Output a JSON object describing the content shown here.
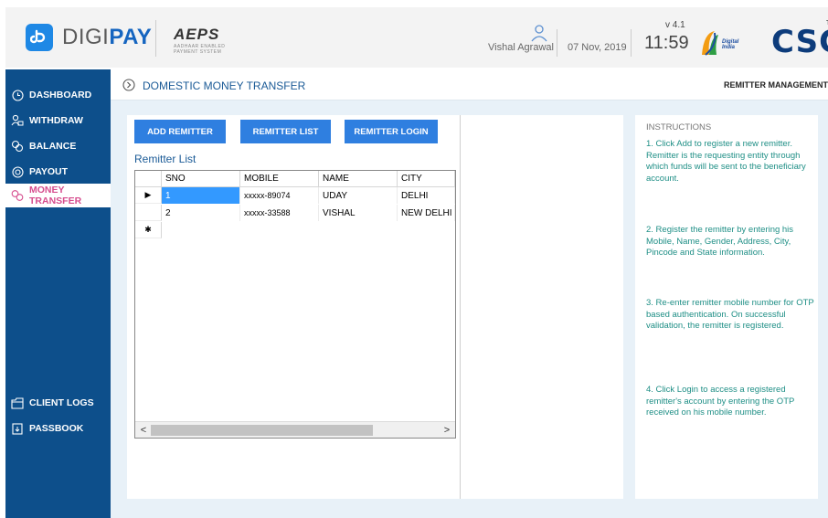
{
  "header": {
    "brand_part1": "DIGI",
    "brand_part2": "PAY",
    "aeps_logo_text": "AEPS",
    "aeps_logo_subtext": "AADHAAR ENABLED PAYMENT SYSTEM",
    "user_name": "Vishal Agrawal",
    "date": "07 Nov, 2019",
    "version": "v 4.1",
    "time": "11:59",
    "digital_india_text": "Digital India",
    "csc_logo_text": "CSC",
    "csc_tm": "TM"
  },
  "sidebar": {
    "items": [
      {
        "label": "DASHBOARD",
        "icon": "clock-icon"
      },
      {
        "label": "WITHDRAW",
        "icon": "user-cash-icon"
      },
      {
        "label": "BALANCE",
        "icon": "wallet-icon"
      },
      {
        "label": "PAYOUT",
        "icon": "payout-icon"
      },
      {
        "label": "MONEY TRANSFER",
        "icon": "transfer-icon"
      },
      {
        "label": "CLIENT LOGS",
        "icon": "folder-icon"
      },
      {
        "label": "PASSBOOK",
        "icon": "passbook-icon"
      }
    ],
    "active": "MONEY TRANSFER"
  },
  "breadcrumb": {
    "title": "DOMESTIC MONEY TRANSFER",
    "right_label": "REMITTER MANAGEMENT"
  },
  "buttons": {
    "add_remitter": "ADD REMITTER",
    "remitter_list": "REMITTER LIST",
    "remitter_login": "REMITTER LOGIN"
  },
  "remitter_list": {
    "title": "Remitter List",
    "columns": [
      "SNO",
      "MOBILE",
      "NAME",
      "CITY"
    ],
    "rows": [
      {
        "sno": "1",
        "mobile": "xxxxx-89074",
        "name": "UDAY",
        "city": "DELHI"
      },
      {
        "sno": "2",
        "mobile": "xxxxx-33588",
        "name": "VISHAL",
        "city": "NEW DELHI"
      }
    ],
    "current_row_marker": "▶",
    "new_row_marker": "✱",
    "scroll_left": "<",
    "scroll_right": ">"
  },
  "instructions": {
    "title": "INSTRUCTIONS",
    "steps": [
      "1. Click Add to register a new remitter. Remitter is the requesting entity through which funds will be sent to the beneficiary account.",
      "2. Register the remitter by entering his Mobile, Name, Gender, Address, City, Pincode and State information.",
      "3. Re-enter remitter mobile number for OTP based authentication. On successful validation, the remitter is registered.",
      "4. Click Login to access a registered remitter's account by entering the OTP received on his mobile number."
    ]
  },
  "colors": {
    "sidebar_bg": "#0d4f8b",
    "accent_blue": "#2f7fe0",
    "active_nav_text": "#d64d8e",
    "instruction_text": "#1f8f86"
  }
}
